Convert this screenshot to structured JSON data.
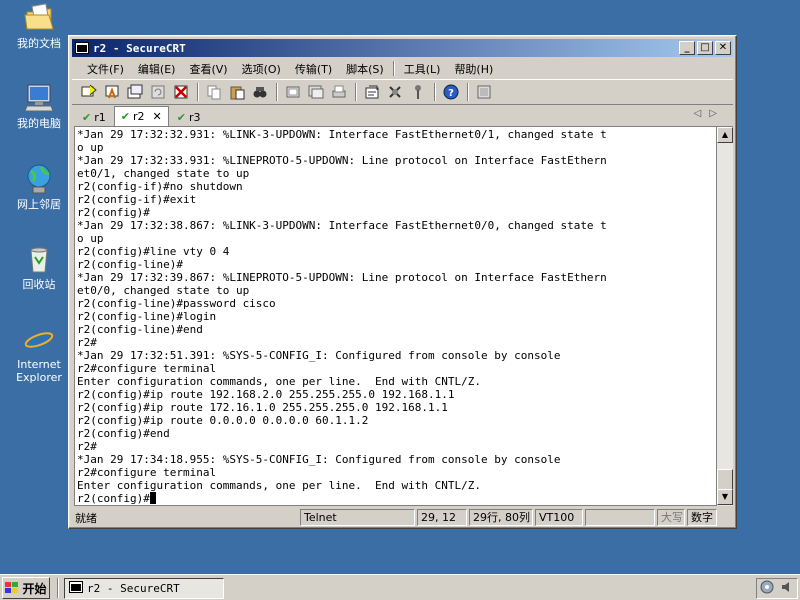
{
  "desktop": {
    "icons": [
      {
        "label": "我的文档"
      },
      {
        "label": "我的电脑"
      },
      {
        "label": "网上邻居"
      },
      {
        "label": "回收站"
      },
      {
        "label": "Internet Explorer"
      }
    ]
  },
  "window": {
    "title": "r2 - SecureCRT",
    "menu": [
      "文件(F)",
      "编辑(E)",
      "查看(V)",
      "选项(O)",
      "传输(T)",
      "脚本(S)",
      "工具(L)",
      "帮助(H)"
    ],
    "tabs": [
      {
        "label": "r1",
        "active": false
      },
      {
        "label": "r2",
        "active": true
      },
      {
        "label": "r3",
        "active": false
      }
    ],
    "terminal_lines": [
      "*Jan 29 17:32:32.931: %LINK-3-UPDOWN: Interface FastEthernet0/1, changed state t",
      "o up",
      "*Jan 29 17:32:33.931: %LINEPROTO-5-UPDOWN: Line protocol on Interface FastEthern",
      "et0/1, changed state to up",
      "r2(config-if)#no shutdown",
      "r2(config-if)#exit",
      "r2(config)#",
      "*Jan 29 17:32:38.867: %LINK-3-UPDOWN: Interface FastEthernet0/0, changed state t",
      "o up",
      "r2(config)#line vty 0 4",
      "r2(config-line)#",
      "*Jan 29 17:32:39.867: %LINEPROTO-5-UPDOWN: Line protocol on Interface FastEthern",
      "et0/0, changed state to up",
      "r2(config-line)#password cisco",
      "r2(config-line)#login",
      "r2(config-line)#end",
      "r2#",
      "*Jan 29 17:32:51.391: %SYS-5-CONFIG_I: Configured from console by console",
      "r2#configure terminal",
      "Enter configuration commands, one per line.  End with CNTL/Z.",
      "r2(config)#ip route 192.168.2.0 255.255.255.0 192.168.1.1",
      "r2(config)#ip route 172.16.1.0 255.255.255.0 192.168.1.1",
      "r2(config)#ip route 0.0.0.0 0.0.0.0 60.1.1.2",
      "r2(config)#end",
      "r2#",
      "*Jan 29 17:34:18.955: %SYS-5-CONFIG_I: Configured from console by console",
      "r2#configure terminal",
      "Enter configuration commands, one per line.  End with CNTL/Z."
    ],
    "prompt_line": "r2(config)#",
    "status": {
      "ready": "就绪",
      "protocol": "Telnet",
      "cursor_pos": "29, 12",
      "size": "29行, 80列",
      "emulation": "VT100",
      "blank": "",
      "caps": "大写",
      "num": "数字"
    }
  },
  "taskbar": {
    "start_label": "开始",
    "task_label": "r2 - SecureCRT"
  }
}
